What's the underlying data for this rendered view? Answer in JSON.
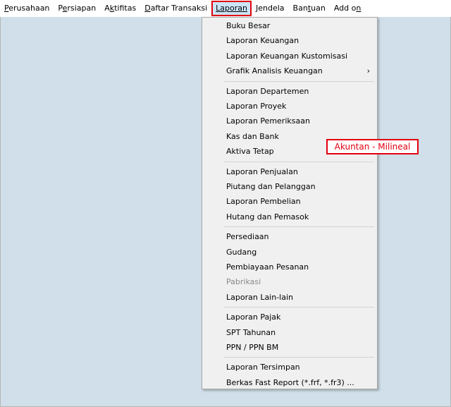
{
  "menubar": {
    "items": [
      {
        "key": "P",
        "rest": "erusahaan"
      },
      {
        "key": "P",
        "pre": "",
        "rest": "ersiapan"
      },
      {
        "pre": "A",
        "key": "k",
        "rest": "tifitas"
      },
      {
        "key": "D",
        "rest": "aftar Transaksi"
      },
      {
        "key": "L",
        "rest": "aporan"
      },
      {
        "key": "J",
        "rest": "endela"
      },
      {
        "key": "B",
        "rest": "antuan"
      },
      {
        "pre": "Add o",
        "key": "n",
        "rest": ""
      }
    ],
    "labels": [
      "Perusahaan",
      "Persiapan",
      "Aktifitas",
      "Daftar Transaksi",
      "Laporan",
      "Jendela",
      "Bantuan",
      "Add on"
    ]
  },
  "dropdown": {
    "groups": [
      [
        "Buku Besar",
        "Laporan Keuangan",
        "Laporan Keuangan Kustomisasi",
        "Grafik Analisis Keuangan"
      ],
      [
        "Laporan Departemen",
        "Laporan Proyek",
        "Laporan Pemeriksaan",
        "Kas dan Bank",
        "Aktiva Tetap"
      ],
      [
        "Laporan Penjualan",
        "Piutang dan Pelanggan",
        "Laporan Pembelian",
        "Hutang dan Pemasok"
      ],
      [
        "Persediaan",
        "Gudang",
        "Pembiayaan Pesanan",
        "Pabrikasi",
        "Laporan Lain-lain"
      ],
      [
        "Laporan Pajak",
        "SPT Tahunan",
        "PPN / PPN BM"
      ],
      [
        "Laporan Tersimpan",
        "Berkas Fast Report (*.frf, *.fr3) ..."
      ]
    ],
    "submenu_arrow": "›",
    "disabled": [
      "Pabrikasi"
    ],
    "has_submenu": [
      "Grafik Analisis Keuangan"
    ]
  },
  "watermark": {
    "text": "Akuntan - Milineal"
  },
  "colors": {
    "highlight_border": "#e3000f",
    "workspace_bg": "#d0dfe9",
    "menu_bg": "#f0f0f0",
    "active_menu_bg": "#cce4f7",
    "disabled_text": "#8a8a8a"
  }
}
